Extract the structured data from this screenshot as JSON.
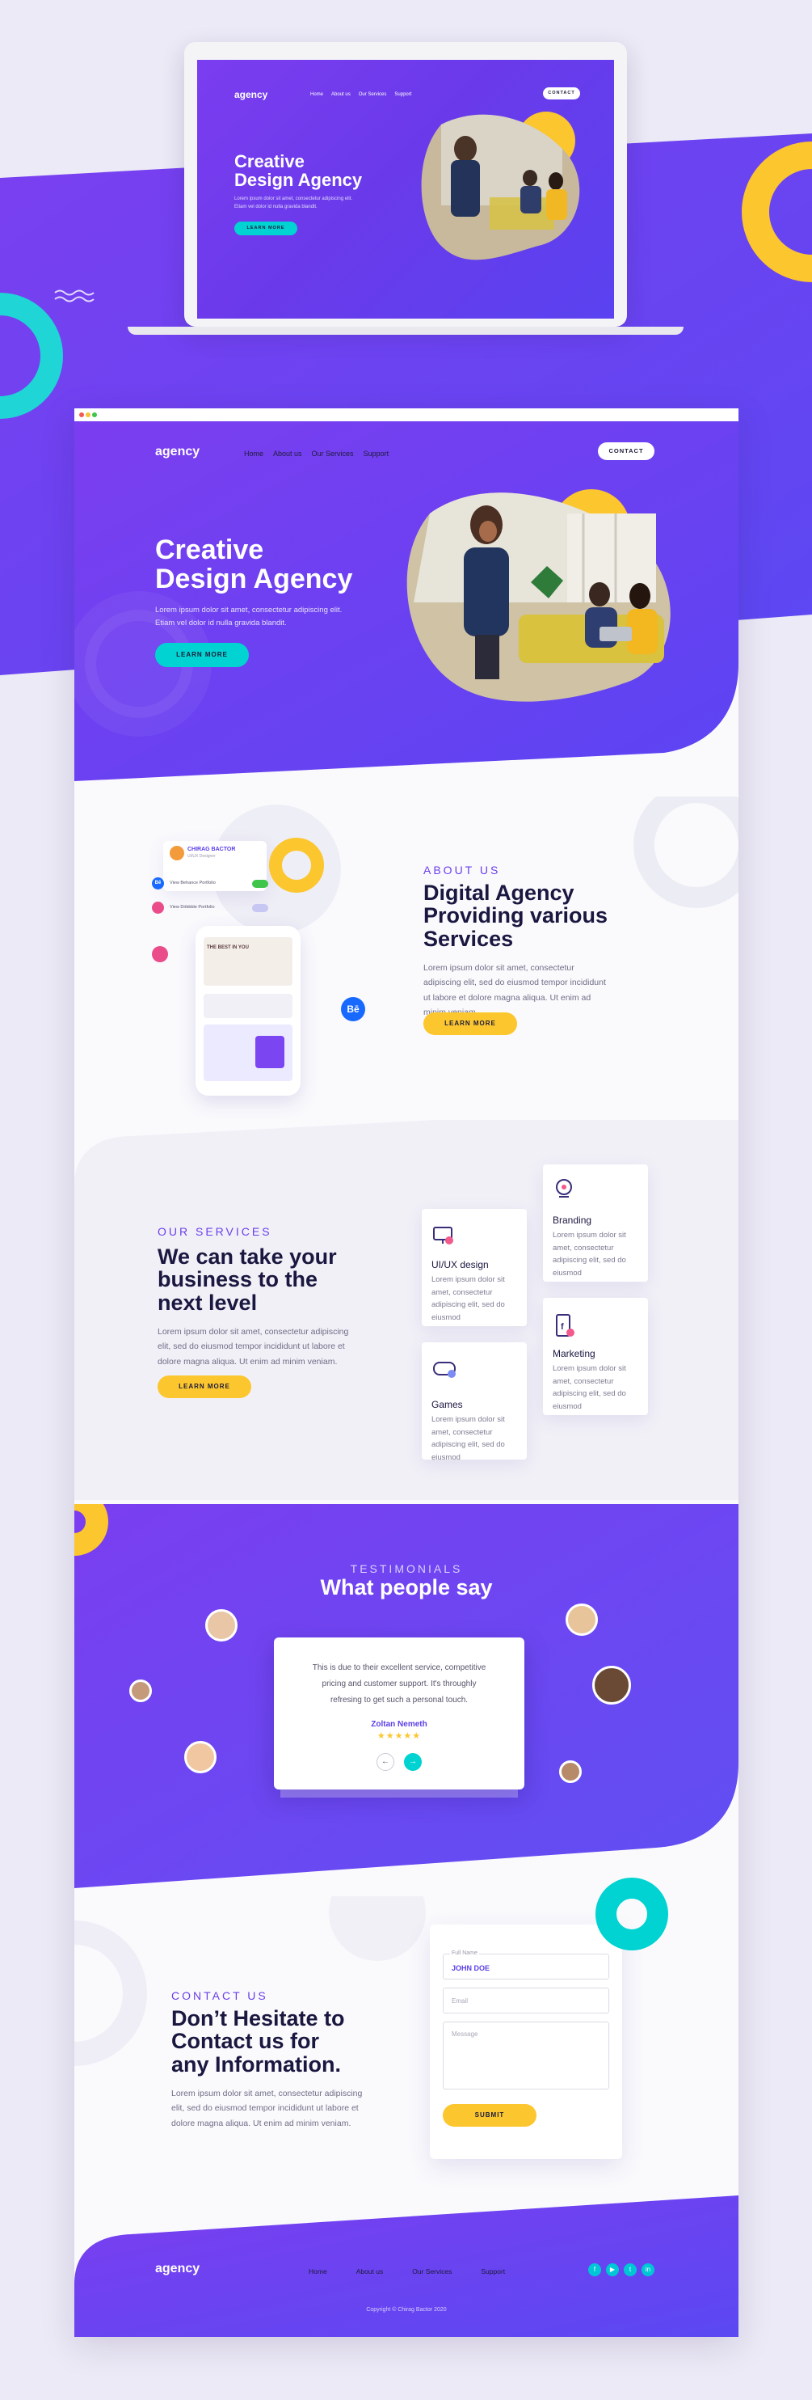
{
  "brand": "agency",
  "nav": [
    "Home",
    "About us",
    "Our Services",
    "Support"
  ],
  "contact_btn": "CONTACT",
  "hero": {
    "title_line1": "Creative",
    "title_line2": "Design Agency",
    "text_line1": "Lorem ipsum dolor sit amet, consectetur adipiscing elit.",
    "text_line2": "Etiam vel dolor id nulla gravida blandit.",
    "cta": "LEARN MORE"
  },
  "about": {
    "eyebrow": "ABOUT US",
    "title_line1": "Digital Agency",
    "title_line2": "Providing various",
    "title_line3": "Services",
    "text": "Lorem ipsum dolor sit amet, consectetur adipiscing elit, sed do eiusmod tempor incididunt ut labore et dolore magna aliqua. Ut enim ad minim veniam.",
    "cta": "LEARN MORE",
    "profile": {
      "name": "CHIRAG BACTOR",
      "role": "UI/UX Designer",
      "row1": "View Behance Portfolio",
      "row2": "View Dribbble Portfolio"
    },
    "phone_headline": "THE BEST IN YOU"
  },
  "services": {
    "eyebrow": "OUR SERVICES",
    "title_line1": "We can take your",
    "title_line2": "business to the",
    "title_line3": "next level",
    "text": "Lorem ipsum dolor sit amet, consectetur adipiscing elit, sed do eiusmod tempor incididunt ut labore et dolore magna aliqua. Ut enim ad minim veniam.",
    "cta": "LEARN MORE",
    "cards": [
      {
        "title": "UI/UX design",
        "text": "Lorem ipsum dolor sit amet, consectetur adipiscing elit, sed do eiusmod"
      },
      {
        "title": "Branding",
        "text": "Lorem ipsum dolor sit amet, consectetur adipiscing elit, sed do eiusmod"
      },
      {
        "title": "Games",
        "text": "Lorem ipsum dolor sit amet, consectetur adipiscing elit, sed do eiusmod"
      },
      {
        "title": "Marketing",
        "text": "Lorem ipsum dolor sit amet, consectetur adipiscing elit, sed do eiusmod"
      }
    ]
  },
  "testimonials": {
    "eyebrow": "TESTIMONIALS",
    "title": "What people say",
    "quote_line1": "This is due to their excellent service, competitive",
    "quote_line2": "pricing and customer support. It's throughly",
    "quote_line3": "refresing to get such a personal touch.",
    "author": "Zoltan Nemeth",
    "stars": "★★★★★",
    "prev": "←",
    "next": "→"
  },
  "contact": {
    "eyebrow": "CONTACT US",
    "title_line1": "Don’t Hesitate to",
    "title_line2": "Contact us for",
    "title_line3": "any Information.",
    "text": "Lorem ipsum dolor sit amet, consectetur adipiscing elit, sed do eiusmod tempor incididunt ut labore et dolore magna aliqua. Ut enim ad minim veniam.",
    "form": {
      "fullname_label": "Full Name",
      "fullname_value": "JOHN DOE",
      "email_placeholder": "Email",
      "message_placeholder": "Message",
      "submit": "SUBMIT"
    }
  },
  "footer": {
    "brand": "agency",
    "links": [
      "Home",
      "About us",
      "Our Services",
      "Support"
    ],
    "copyright": "Copyright © Chirag Bactor 2020",
    "social": [
      "f",
      "▶",
      "t",
      "in"
    ]
  },
  "laptop": {
    "brand": "agency",
    "nav": [
      "Home",
      "About us",
      "Our Services",
      "Support"
    ],
    "contact": "CONTACT",
    "title_line1": "Creative",
    "title_line2": "Design Agency",
    "text_line1": "Lorem ipsum dolor sit amet, consectetur adipiscing elit.",
    "text_line2": "Etiam vel dolor id nulla gravida blandit.",
    "cta": "LEARN MORE"
  },
  "colors": {
    "purple": "#6b3df0",
    "cyan": "#00d3d1",
    "yellow": "#fcc62e",
    "dark": "#1a1740"
  }
}
